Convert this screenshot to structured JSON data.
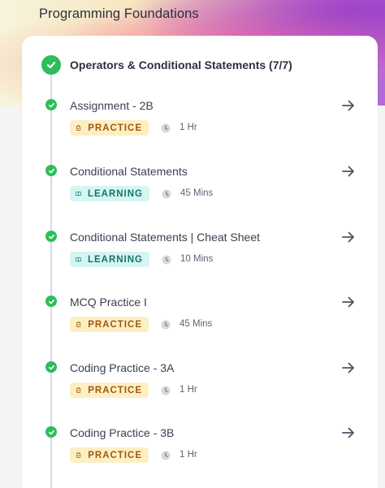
{
  "page": {
    "title": "Programming Foundations"
  },
  "section": {
    "title": "Operators & Conditional Statements (7/7)"
  },
  "items": [
    {
      "title": "Assignment - 2B",
      "type": "PRACTICE",
      "duration": "1 Hr"
    },
    {
      "title": "Conditional Statements",
      "type": "LEARNING",
      "duration": "45 Mins"
    },
    {
      "title": "Conditional Statements | Cheat Sheet",
      "type": "LEARNING",
      "duration": "10 Mins"
    },
    {
      "title": "MCQ Practice I",
      "type": "PRACTICE",
      "duration": "45 Mins"
    },
    {
      "title": "Coding Practice - 3A",
      "type": "PRACTICE",
      "duration": "1 Hr"
    },
    {
      "title": "Coding Practice - 3B",
      "type": "PRACTICE",
      "duration": "1 Hr"
    }
  ],
  "icons": {
    "complete": "check-circle-icon",
    "practice": "clipboard-icon",
    "learning": "book-icon",
    "duration": "clock-icon",
    "open": "arrow-right-icon"
  },
  "colors": {
    "complete_green": "#2dbd5a",
    "practice_bg": "#fdefc4",
    "practice_text": "#a2580a",
    "learning_bg": "#d3f6f2",
    "learning_text": "#1a7168"
  }
}
